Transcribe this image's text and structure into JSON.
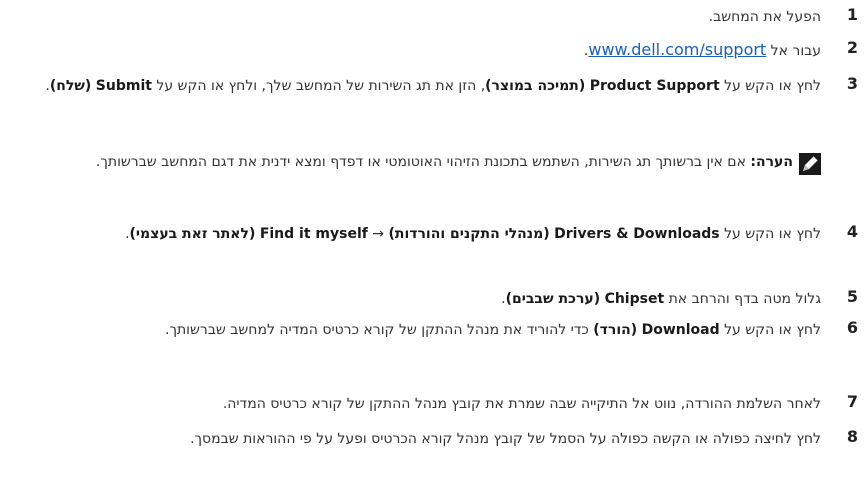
{
  "steps": [
    {
      "num": "1",
      "text": "הפעל את המחשב."
    },
    {
      "num": "2",
      "before": "עבור אל ",
      "link": "www.dell.com/support",
      "after": "."
    },
    {
      "num": "3",
      "p1": "לחץ או הקש על ",
      "b1": "Product Support",
      "b2": "(תמיכה במוצר)",
      "p2": ", הזן את תג השירות של המחשב שלך, ולחץ או הקש על ",
      "b3": "Submit",
      "b4": "(שלח)",
      "p3": "."
    },
    {
      "num": "4",
      "p1": "לחץ או הקש על ",
      "b1": "Drivers & Downloads",
      "b2": "(מנהלי התקנים והורדות)",
      "arrow": " → ",
      "b3": "Find it myself",
      "b4": "(לאתר זאת בעצמי)",
      "p2": "."
    },
    {
      "num": "5",
      "p1": "גלול מטה בדף והרחב את ",
      "b1": "Chipset",
      "b2": "(ערכת שבבים)",
      "p2": "."
    },
    {
      "num": "6",
      "p1": "לחץ או הקש על ",
      "b1": "Download",
      "b2": "(הורד)",
      "p2": " כדי להוריד את מנהל ההתקן של קורא כרטיס המדיה למחשב שברשותך."
    },
    {
      "num": "7",
      "text": "לאחר השלמת ההורדה, נווט אל התיקייה שבה שמרת את קובץ מנהל ההתקן של קורא כרטיס המדיה."
    },
    {
      "num": "8",
      "text": "לחץ לחיצה כפולה או הקשה כפולה על הסמל של קובץ מנהל קורא הכרטיס ופעל על פי ההוראות שבמסך."
    }
  ],
  "note": {
    "label": "הערה:",
    "text": " אם אין ברשותך תג השירות, השתמש בתכונת הזיהוי האוטומטי או דפדף ומצא ידנית את דגם המחשב שברשותך.",
    "icon": "pencil-note-icon"
  }
}
